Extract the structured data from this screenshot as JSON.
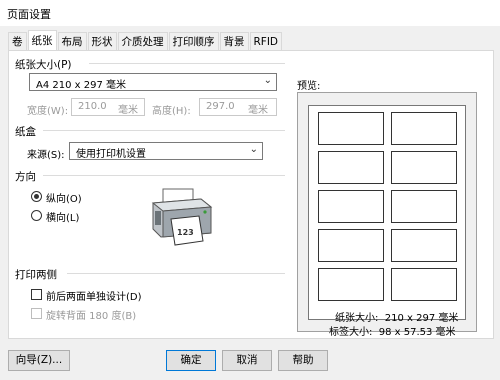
{
  "window": {
    "title": "页面设置"
  },
  "tabs": [
    "卷",
    "纸张",
    "布局",
    "形状",
    "介质处理",
    "打印顺序",
    "背景",
    "RFID"
  ],
  "active_tab": "纸张",
  "paper_size": {
    "group_label": "纸张大小(P)",
    "selected": "A4 210 x 297 毫米",
    "width_label": "宽度(W):",
    "width_value": "210.0",
    "width_unit": "毫米",
    "height_label": "高度(H):",
    "height_value": "297.0",
    "height_unit": "毫米"
  },
  "tray": {
    "group_label": "纸盒",
    "source_label": "来源(S):",
    "source_value": "使用打印机设置"
  },
  "orientation": {
    "group_label": "方向",
    "portrait_label": "纵向(O)",
    "landscape_label": "横向(L)",
    "selected": "portrait"
  },
  "duplex": {
    "group_label": "打印两侧",
    "separate_label": "前后两面单独设计(D)",
    "rotate_label": "旋转背面 180 度(B)"
  },
  "preview": {
    "label": "预览:",
    "paper_size_text": "纸张大小:  210 x 297 毫米",
    "label_size_text": "标签大小:  98 x 57.53 毫米"
  },
  "buttons": {
    "wizard": "向导(Z)...",
    "ok": "确定",
    "cancel": "取消",
    "help": "帮助"
  }
}
